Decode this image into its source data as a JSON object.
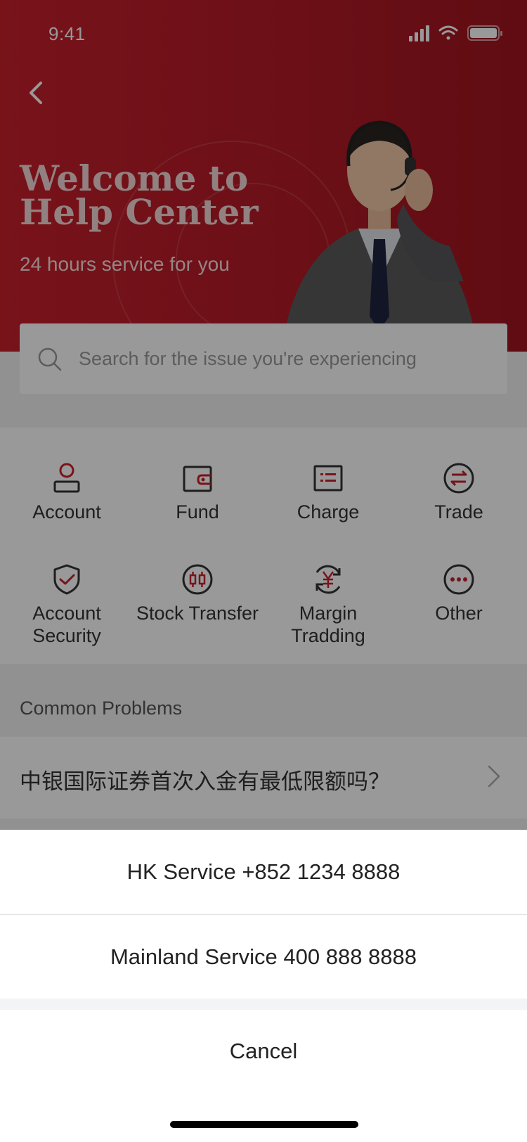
{
  "status_bar": {
    "time": "9:41"
  },
  "hero": {
    "title": "Welcome to Help Center",
    "subtitle": "24 hours service for you"
  },
  "search": {
    "placeholder": "Search for the issue you're experiencing"
  },
  "categories": [
    {
      "label": "Account",
      "icon": "user-icon"
    },
    {
      "label": "Fund",
      "icon": "wallet-icon"
    },
    {
      "label": "Charge",
      "icon": "list-card-icon"
    },
    {
      "label": "Trade",
      "icon": "exchange-icon"
    },
    {
      "label": "Account Security",
      "icon": "shield-check-icon"
    },
    {
      "label": "Stock Transfer",
      "icon": "candlestick-icon"
    },
    {
      "label": "Margin Tradding",
      "icon": "yen-refresh-icon"
    },
    {
      "label": "Other",
      "icon": "more-dots-icon"
    }
  ],
  "common_problems": {
    "title": "Common Problems",
    "items": [
      {
        "text": "中银国际证券首次入金有最低限额吗？"
      }
    ]
  },
  "action_sheet": {
    "options": [
      {
        "label": "HK Service +852 1234 8888"
      },
      {
        "label": "Mainland Service 400 888 8888"
      }
    ],
    "cancel_label": "Cancel"
  },
  "colors": {
    "brand_red": "#c8202c",
    "icon_red": "#c8202c",
    "icon_dark": "#333333",
    "overlay": "rgba(0,0,0,0.40)"
  }
}
